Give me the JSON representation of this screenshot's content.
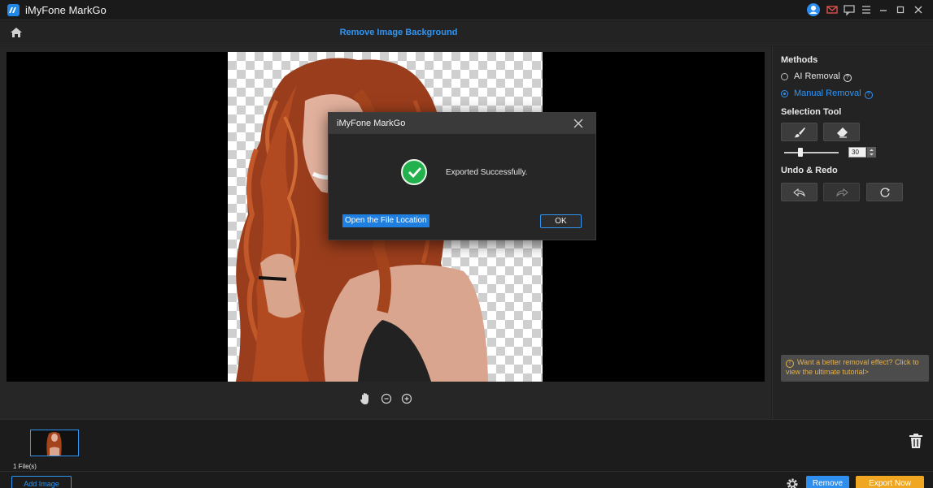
{
  "window": {
    "app_title": "iMyFone MarkGo"
  },
  "toolbar": {
    "page_title": "Remove Image Background"
  },
  "methods": {
    "title": "Methods",
    "ai_removal": "AI Removal",
    "manual_removal": "Manual Removal",
    "selected": "manual_removal"
  },
  "selection_tool": {
    "title": "Selection Tool",
    "brush_size": "30",
    "brush_level": 0.3
  },
  "undo_redo": {
    "title": "Undo & Redo"
  },
  "tip": {
    "text": "Want a better removal effect? Click to view the ultimate tutorial>"
  },
  "files": {
    "count_label": "1 File(s)"
  },
  "footer": {
    "add_image": "Add Image",
    "remove": "Remove",
    "export_now": "Export Now"
  },
  "dialog": {
    "title": "iMyFone MarkGo",
    "message": "Exported Successfully.",
    "open_location": "Open the File Location",
    "ok": "OK"
  },
  "colors": {
    "accent": "#2e95f5",
    "export": "#f1a622",
    "success": "#22b14c",
    "tip_text": "#e8b146"
  }
}
